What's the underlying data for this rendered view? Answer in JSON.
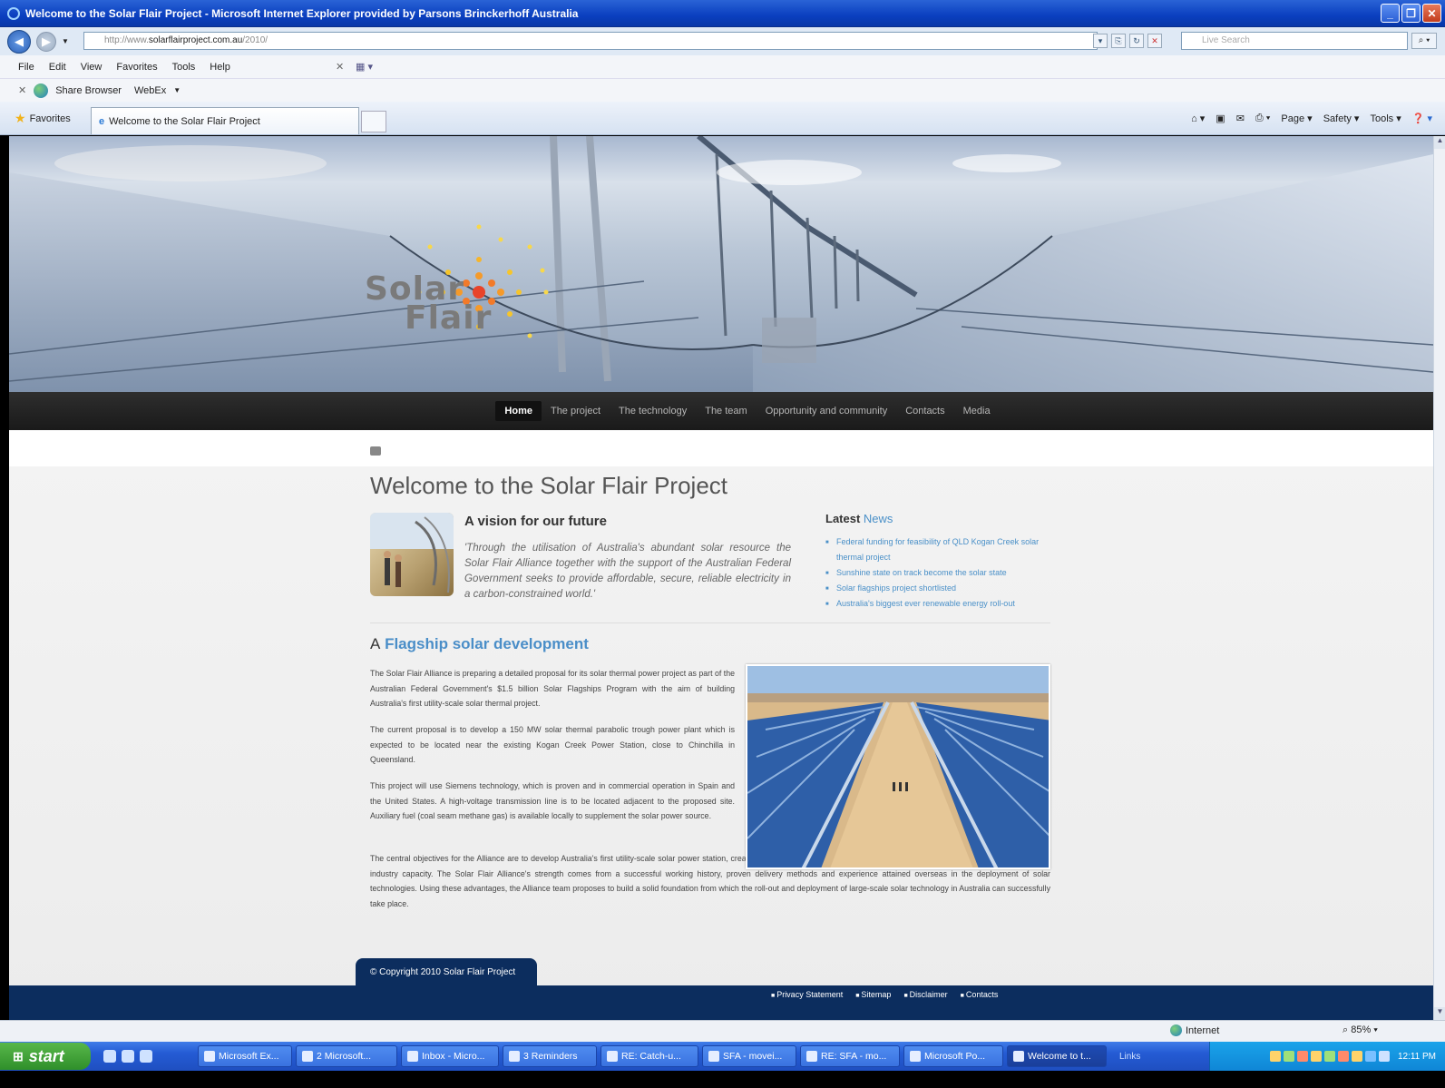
{
  "window": {
    "title": "Welcome to the Solar Flair Project - Microsoft Internet Explorer provided by Parsons Brinckerhoff Australia"
  },
  "address_bar": {
    "url_prefix": "http://www.",
    "url_domain": "solarflairproject.com.au",
    "url_suffix": "/2010/",
    "search_placeholder": "Live Search"
  },
  "menu": {
    "items": [
      "File",
      "Edit",
      "View",
      "Favorites",
      "Tools",
      "Help"
    ]
  },
  "links_toolbar": {
    "share_browser": "Share Browser",
    "webex": "WebEx"
  },
  "tabs": {
    "favorites_label": "Favorites",
    "active_tab": "Welcome to the Solar Flair Project"
  },
  "command_bar": {
    "page": "Page",
    "safety": "Safety",
    "tools": "Tools"
  },
  "site": {
    "logo_line1": "Solar",
    "logo_line2": "Flair",
    "nav": [
      "Home",
      "The project",
      "The technology",
      "The team",
      "Opportunity and community",
      "Contacts",
      "Media"
    ],
    "page_title": "Welcome to the Solar Flair Project",
    "vision_heading": "A vision for our future",
    "vision_quote": "'Through the utilisation of Australia's abundant solar resource the Solar Flair Alliance together with the support of the Australian Federal Government seeks to provide affordable, secure, reliable electricity in a carbon-constrained world.'",
    "news_heading_a": "Latest",
    "news_heading_b": "News",
    "news": [
      "Federal funding for feasibility of QLD Kogan Creek solar thermal project",
      "Sunshine state on track become the solar state",
      "Solar flagships project shortlisted",
      "Australia's biggest ever renewable energy roll-out"
    ],
    "flagship_a": "A",
    "flagship_b": "Flagship solar development",
    "para1": "The Solar Flair Alliance is preparing a detailed proposal for its solar thermal power project as part of the Australian Federal Government's $1.5 billion Solar Flagships Program with the aim of building Australia's first utility-scale solar thermal project.",
    "para2": "The current proposal is to develop a 150 MW solar thermal parabolic trough power plant which is expected to be located near the existing Kogan Creek Power Station, close to Chinchilla in Queensland.",
    "para3": "This project will use Siemens technology, which is proven and in commercial operation in Spain and the United States. A high-voltage transmission line is to be located adjacent to the proposed site. Auxiliary fuel (coal seam methane gas) is available locally to supplement the solar power source.",
    "para4": "The central objectives for the Alliance are to develop Australia's first utility-scale solar power station, create a commercially viable renewable energy enterprise and expand the country's solar industry capacity.  The Solar Flair Alliance's strength comes from a successful working history, proven delivery methods and experience attained overseas in the deployment of solar technologies. Using these advantages, the Alliance team proposes to build a solid foundation from which the roll-out and deployment of large-scale solar technology in Australia can successfully take place.",
    "copyright": "© Copyright 2010 Solar Flair Project",
    "footer_links": [
      "Privacy Statement",
      "Sitemap",
      "Disclaimer",
      "Contacts"
    ]
  },
  "status_bar": {
    "zone": "Internet",
    "zoom": "85%"
  },
  "taskbar": {
    "start": "start",
    "tasks": [
      "Microsoft Ex...",
      "2 Microsoft...",
      "Inbox - Micro...",
      "3 Reminders",
      "RE: Catch-u...",
      "SFA - movei...",
      "RE: SFA - mo...",
      "Microsoft Po...",
      "Welcome to t..."
    ],
    "links": "Links",
    "clock": "12:11 PM"
  },
  "colors": {
    "nav_bg": "#1f1f1f",
    "footer_bg": "#0c2d5e",
    "accent_blue": "#4a8ec8",
    "titlebar_blue": "#0a3fbf"
  }
}
